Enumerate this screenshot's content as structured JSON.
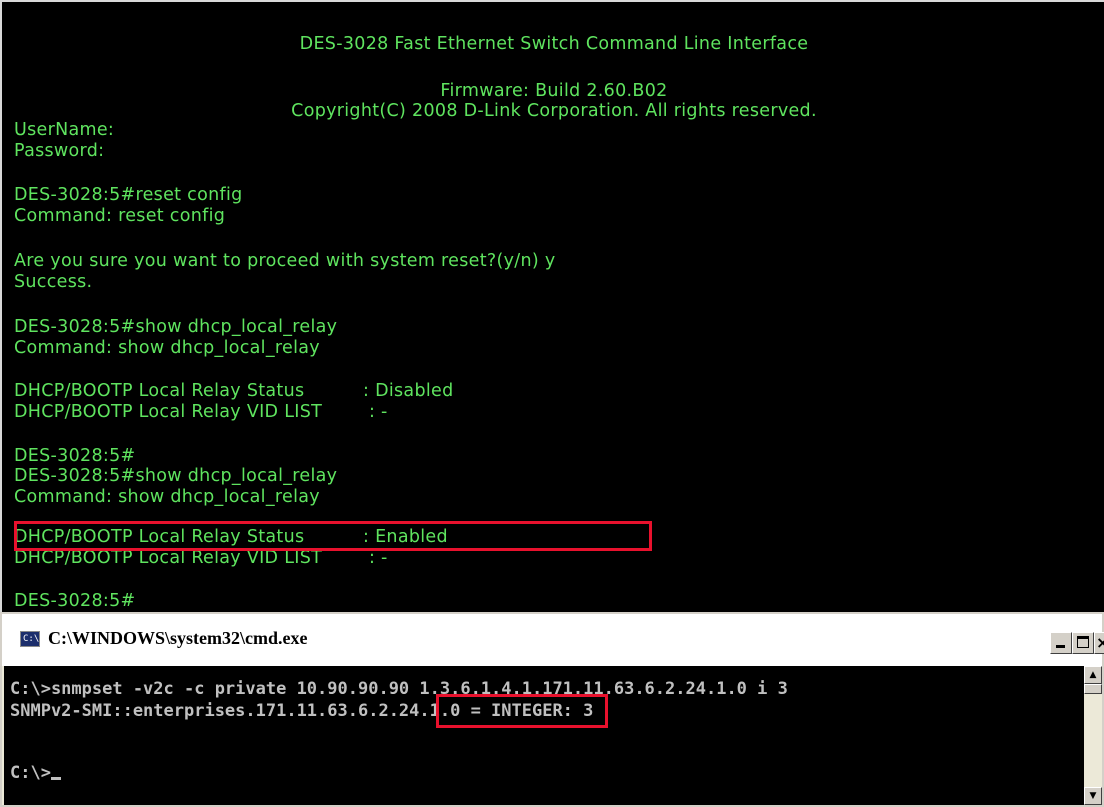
{
  "switch_cli": {
    "header_title": "DES-3028 Fast Ethernet Switch Command Line Interface",
    "header_firmware": "Firmware: Build 2.60.B02",
    "header_copyright": "Copyright(C) 2008 D-Link Corporation. All rights reserved.",
    "lines": [
      "UserName:",
      "Password:",
      "DES-3028:5#reset config",
      "Command: reset config",
      "Are you sure you want to proceed with system reset?(y/n) y",
      "Success.",
      "DES-3028:5#show dhcp_local_relay",
      "Command: show dhcp_local_relay",
      "DHCP/BOOTP Local Relay Status          : Disabled",
      "DHCP/BOOTP Local Relay VID LIST        : -",
      "DES-3028:5#",
      "DES-3028:5#show dhcp_local_relay",
      "Command: show dhcp_local_relay",
      "DHCP/BOOTP Local Relay Status          : Enabled",
      "DHCP/BOOTP Local Relay VID LIST        : -",
      "DES-3028:5#"
    ],
    "text_color": "#5fe45f",
    "background_color": "#000000",
    "highlight_color": "#e8112d"
  },
  "cmd_window": {
    "title": "C:\\WINDOWS\\system32\\cmd.exe",
    "icon": "cmd-window-icon",
    "icon_label": "C:\\",
    "buttons": {
      "minimize": "minimize-icon",
      "maximize": "maximize-icon",
      "close_label": "×"
    },
    "lines": [
      "C:\\>snmpset -v2c -c private 10.90.90.90 1.3.6.1.4.1.171.11.63.6.2.24.1.0 i 3",
      "SNMPv2-SMI::enterprises.171.11.63.6.2.24.1.0 = INTEGER: 3",
      "",
      "C:\\>"
    ],
    "scroll_up": "▲",
    "scroll_down": "▼"
  }
}
